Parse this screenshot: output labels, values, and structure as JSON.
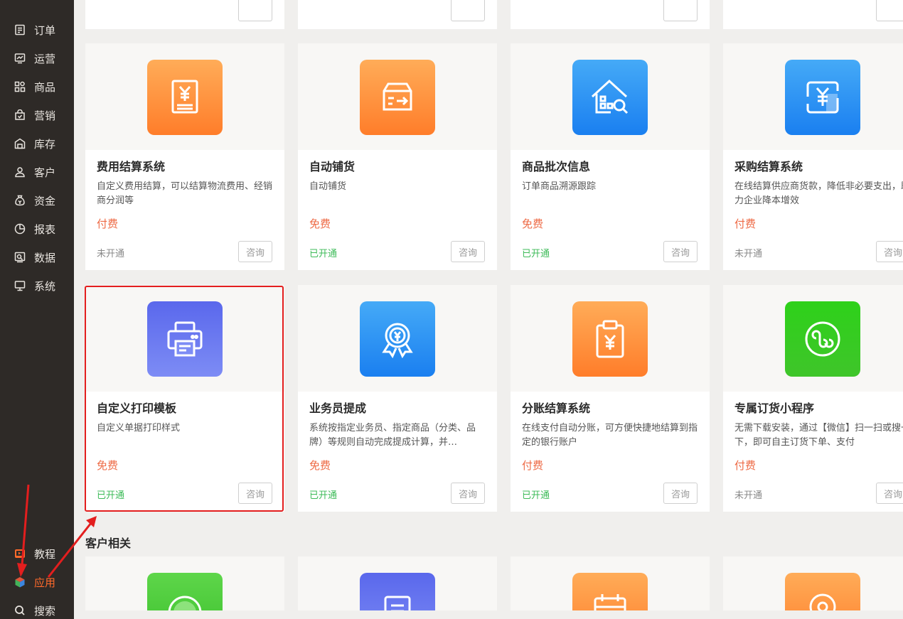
{
  "sidebar": {
    "items": [
      {
        "label": "订单",
        "icon": "order-icon"
      },
      {
        "label": "运营",
        "icon": "operations-icon"
      },
      {
        "label": "商品",
        "icon": "goods-icon"
      },
      {
        "label": "营销",
        "icon": "marketing-icon"
      },
      {
        "label": "库存",
        "icon": "inventory-icon"
      },
      {
        "label": "客户",
        "icon": "customer-icon"
      },
      {
        "label": "资金",
        "icon": "funds-icon"
      },
      {
        "label": "报表",
        "icon": "report-icon"
      },
      {
        "label": "数据",
        "icon": "data-icon"
      },
      {
        "label": "系统",
        "icon": "system-icon"
      }
    ],
    "bottom": {
      "tutorial": "教程",
      "apps": "应用",
      "search": "搜索"
    }
  },
  "colors": {
    "accent": "#ff6a2b",
    "price": "#ee6a45",
    "enabled": "#3dbb58",
    "highlight": "#e31e1e"
  },
  "cards": [
    {
      "title": "费用结算系统",
      "desc": "自定义费用结算，可以结算物流费用、经销商分润等",
      "price": "付费",
      "status": "未开通",
      "action": "咨询",
      "icon": "expense-settlement-icon"
    },
    {
      "title": "自动铺货",
      "desc": "自动铺货",
      "price": "免费",
      "status": "已开通",
      "action": "咨询",
      "icon": "auto-distribution-icon"
    },
    {
      "title": "商品批次信息",
      "desc": "订单商品溯源跟踪",
      "price": "免费",
      "status": "已开通",
      "action": "咨询",
      "icon": "batch-info-icon"
    },
    {
      "title": "采购结算系统",
      "desc": "在线结算供应商货款，降低非必要支出，助力企业降本增效",
      "price": "付费",
      "status": "未开通",
      "action": "咨询",
      "icon": "purchase-settlement-icon"
    },
    {
      "title": "自定义打印模板",
      "desc": "自定义单据打印样式",
      "price": "免费",
      "status": "已开通",
      "action": "咨询",
      "icon": "printer-icon"
    },
    {
      "title": "业务员提成",
      "desc": "系统按指定业务员、指定商品（分类、品牌）等规则自动完成提成计算，并…",
      "price": "免费",
      "status": "已开通",
      "action": "咨询",
      "icon": "commission-medal-icon"
    },
    {
      "title": "分账结算系统",
      "desc": "在线支付自动分账，可方便快捷地结算到指定的银行账户",
      "price": "付费",
      "status": "已开通",
      "action": "咨询",
      "icon": "split-settlement-icon"
    },
    {
      "title": "专属订货小程序",
      "desc": "无需下载安装，通过【微信】扫一扫或搜一下，即可自主订货下单、支付",
      "price": "付费",
      "status": "未开通",
      "action": "咨询",
      "icon": "mini-program-icon"
    }
  ],
  "section": {
    "title": "客户相关"
  }
}
